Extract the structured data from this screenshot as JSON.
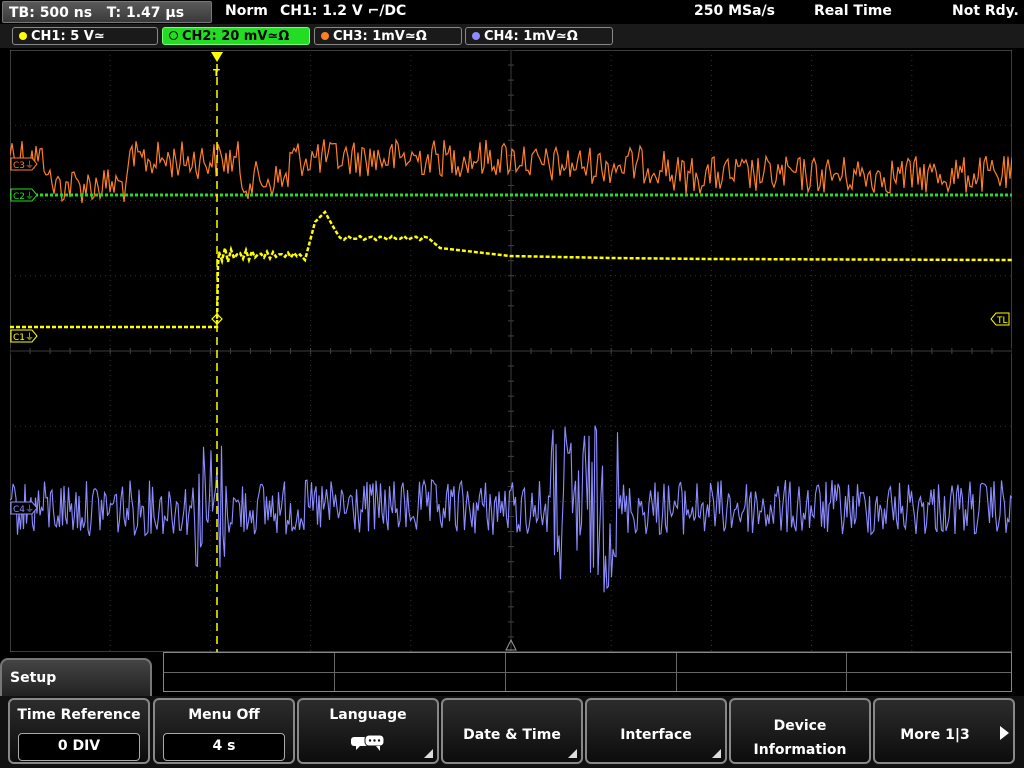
{
  "status": {
    "timebase": "TB: 500 ns   T: 1.47 µs",
    "trigger_mode": "Norm",
    "trigger_info": "CH1: 1.2 V ⌐/DC",
    "sample_rate": "250 MSa/s",
    "acq_mode": "Real Time",
    "state": "Not Rdy."
  },
  "channels": [
    {
      "label": "CH1: 5 V≃",
      "color": "#ffff00",
      "active": false
    },
    {
      "label": "CH2: 20 mV≃Ω",
      "color": "#22dd22",
      "active": true
    },
    {
      "label": "CH3: 1mV≃Ω",
      "color": "#ff7f27",
      "active": false
    },
    {
      "label": "CH4: 1mV≃Ω",
      "color": "#8c8cff",
      "active": false
    }
  ],
  "markers": {
    "c1": "C1⏚",
    "c2": "C2⏚",
    "c3": "C3⏚",
    "c4": "C4⏚",
    "trigger_level": "TL",
    "trigger_pos": "T"
  },
  "menu": {
    "tab": "Setup",
    "keys": [
      {
        "title": "Time Reference",
        "value": "0 DIV"
      },
      {
        "title": "Menu Off",
        "value": "4 s"
      },
      {
        "title": "Language"
      },
      {
        "title": "Date & Time"
      },
      {
        "title": "Interface"
      },
      {
        "line1": "Device",
        "line2": "Information"
      },
      {
        "title": "More 1|3"
      }
    ]
  }
}
